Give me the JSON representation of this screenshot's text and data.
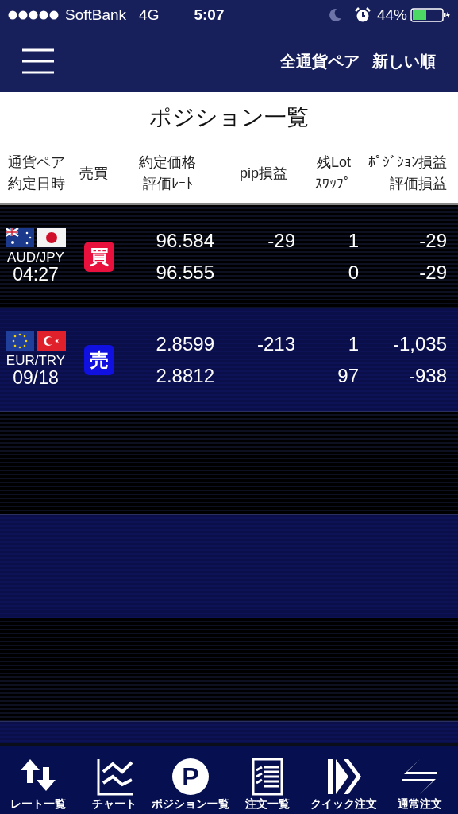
{
  "status_bar": {
    "carrier": "SoftBank",
    "network": "4G",
    "time": "5:07",
    "battery": "44%"
  },
  "nav": {
    "filter": "全通貨ペア",
    "sort": "新しい順"
  },
  "title": "ポジション一覧",
  "columns": [
    {
      "line1": "通貨ペア",
      "line2": "約定日時"
    },
    {
      "line1": "売買"
    },
    {
      "line1": "約定価格",
      "line2": "評価ﾚｰﾄ"
    },
    {
      "line1": "pip損益"
    },
    {
      "line1": "残Lot",
      "line2": "ｽﾜｯﾌﾟ"
    },
    {
      "line1": "ﾎﾟｼﾞｼｮﾝ損益",
      "line2": "評価損益"
    }
  ],
  "rows": [
    {
      "pair": "AUD/JPY",
      "flags": [
        {
          "kind": "au"
        },
        {
          "kind": "jp"
        }
      ],
      "date": "04:27",
      "side": {
        "kind": "buy",
        "label": "買"
      },
      "price": "96.584",
      "rate": "96.555",
      "pips": "-29",
      "lot": "1",
      "swap": "0",
      "pos_pl": "-29",
      "eval_pl": "-29"
    },
    {
      "pair": "EUR/TRY",
      "flags": [
        {
          "kind": "eu"
        },
        {
          "kind": "tr"
        }
      ],
      "date": "09/18",
      "side": {
        "kind": "sell",
        "label": "売"
      },
      "price": "2.8599",
      "rate": "2.8812",
      "pips": "-213",
      "lot": "1",
      "swap": "97",
      "pos_pl": "-1,035",
      "eval_pl": "-938"
    }
  ],
  "tabs": [
    {
      "kind": "rates",
      "label": "レート一覧"
    },
    {
      "kind": "chart",
      "label": "チャート"
    },
    {
      "kind": "position",
      "label": "ポジション一覧",
      "icon_text": "P"
    },
    {
      "kind": "orders",
      "label": "注文一覧"
    },
    {
      "kind": "quick",
      "label": "クイック注文"
    },
    {
      "kind": "normal",
      "label": "通常注文"
    }
  ]
}
